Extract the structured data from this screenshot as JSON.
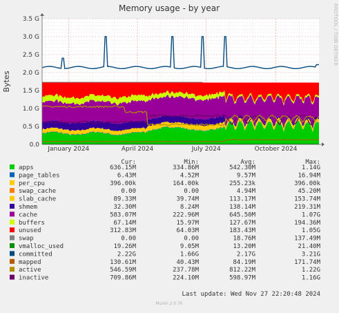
{
  "chart_data": {
    "type": "area",
    "title": "Memory usage - by year",
    "ylabel": "Bytes",
    "side_label": "RRDTOOL / TOBI OETIKER",
    "footer": "Munin 2.0.76",
    "last_update": "Last update: Wed Nov 27 22:20:48 2024",
    "ylim": [
      0,
      3.5
    ],
    "y_unit": "G",
    "y_ticks": [
      {
        "value": 0.0,
        "label": "0.0"
      },
      {
        "value": 0.5,
        "label": "0.5 G"
      },
      {
        "value": 1.0,
        "label": "1.0 G"
      },
      {
        "value": 1.5,
        "label": "1.5 G"
      },
      {
        "value": 2.0,
        "label": "2.0 G"
      },
      {
        "value": 2.5,
        "label": "2.5 G"
      },
      {
        "value": 3.0,
        "label": "3.0 G"
      },
      {
        "value": 3.5,
        "label": "3.5 G"
      }
    ],
    "x_range": [
      "2023-11-27",
      "2024-11-27"
    ],
    "x_ticks": [
      {
        "date": "2024-01-01",
        "label": "January 2024"
      },
      {
        "date": "2024-04-01",
        "label": "April 2024"
      },
      {
        "date": "2024-07-01",
        "label": "July 2024"
      },
      {
        "date": "2024-10-01",
        "label": "October 2024"
      }
    ],
    "grid": true,
    "legend_headers": {
      "cur": "Cur:",
      "min": "Min:",
      "avg": "Avg:",
      "max": "Max:"
    },
    "series": [
      {
        "name": "apps",
        "color": "#00cc00",
        "kind": "area",
        "cur": "636.15M",
        "min": "334.86M",
        "avg": "542.30M",
        "max": "1.14G"
      },
      {
        "name": "page_tables",
        "color": "#0066b3",
        "kind": "area",
        "cur": "6.43M",
        "min": "4.52M",
        "avg": "9.57M",
        "max": "16.94M"
      },
      {
        "name": "per_cpu",
        "color": "#ffcc00",
        "kind": "area",
        "cur": "396.00k",
        "min": "164.00k",
        "avg": "255.23k",
        "max": "396.00k"
      },
      {
        "name": "swap_cache",
        "color": "#ff8000",
        "kind": "area",
        "cur": "0.00",
        "min": "0.00",
        "avg": "4.94M",
        "max": "45.20M"
      },
      {
        "name": "slab_cache",
        "color": "#ffcc00",
        "kind": "area",
        "cur": "89.33M",
        "min": "39.74M",
        "avg": "113.17M",
        "max": "153.74M"
      },
      {
        "name": "shmem",
        "color": "#330099",
        "kind": "area",
        "cur": "32.30M",
        "min": "8.24M",
        "avg": "138.14M",
        "max": "219.31M"
      },
      {
        "name": "cache",
        "color": "#990099",
        "kind": "area",
        "cur": "583.07M",
        "min": "222.96M",
        "avg": "645.50M",
        "max": "1.07G"
      },
      {
        "name": "buffers",
        "color": "#ccff00",
        "kind": "area",
        "cur": "67.14M",
        "min": "15.97M",
        "avg": "127.67M",
        "max": "194.36M"
      },
      {
        "name": "unused",
        "color": "#ff0000",
        "kind": "area",
        "cur": "312.83M",
        "min": "64.03M",
        "avg": "183.43M",
        "max": "1.05G"
      },
      {
        "name": "swap",
        "color": "#808080",
        "kind": "area",
        "cur": "0.00",
        "min": "0.00",
        "avg": "18.76M",
        "max": "137.49M"
      },
      {
        "name": "vmalloc_used",
        "color": "#008f00",
        "kind": "line",
        "cur": "19.26M",
        "min": "9.05M",
        "avg": "13.20M",
        "max": "21.40M"
      },
      {
        "name": "committed",
        "color": "#00487d",
        "kind": "line",
        "cur": "2.22G",
        "min": "1.66G",
        "avg": "2.17G",
        "max": "3.21G"
      },
      {
        "name": "mapped",
        "color": "#b35a00",
        "kind": "line",
        "cur": "130.61M",
        "min": "40.43M",
        "avg": "84.19M",
        "max": "171.74M"
      },
      {
        "name": "active",
        "color": "#b38f00",
        "kind": "line",
        "cur": "546.59M",
        "min": "237.78M",
        "avg": "812.22M",
        "max": "1.22G"
      },
      {
        "name": "inactive",
        "color": "#6b006b",
        "kind": "line",
        "cur": "709.86M",
        "min": "224.10M",
        "avg": "598.97M",
        "max": "1.16G"
      }
    ]
  }
}
